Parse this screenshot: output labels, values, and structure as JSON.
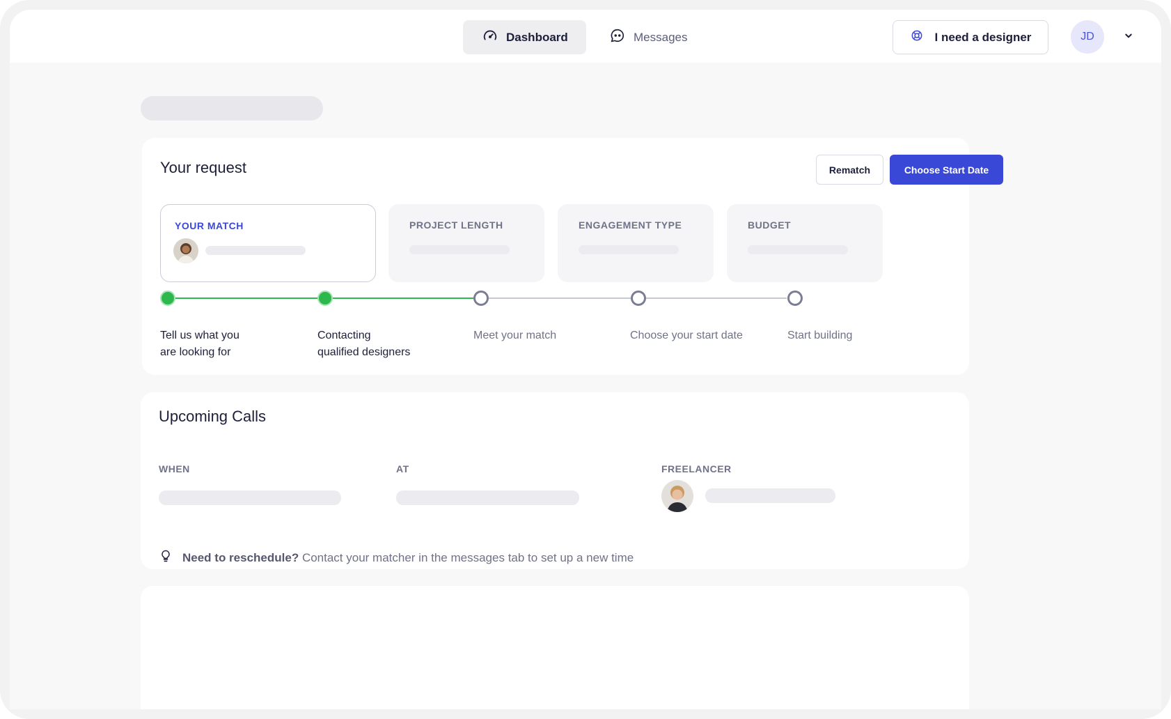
{
  "nav": {
    "tabs": [
      {
        "label": "Dashboard",
        "icon": "speedometer-icon",
        "active": true
      },
      {
        "label": "Messages",
        "icon": "chat-bubble-icon",
        "active": false
      }
    ],
    "cta_label": "I need a designer",
    "cta_icon": "lifebuoy-icon",
    "user_initials": "JD"
  },
  "request": {
    "title": "Your request",
    "rematch_label": "Rematch",
    "start_date_label": "Choose Start Date",
    "info": [
      {
        "label": "YOUR MATCH"
      },
      {
        "label": "PROJECT LENGTH"
      },
      {
        "label": "ENGAGEMENT TYPE"
      },
      {
        "label": "BUDGET"
      }
    ],
    "steps": [
      {
        "line1": "Tell us what you",
        "line2": "are looking for",
        "status": "complete"
      },
      {
        "line1": "Contacting",
        "line2": "qualified designers",
        "status": "complete"
      },
      {
        "line1": "Meet your match",
        "line2": "",
        "status": "pending"
      },
      {
        "line1": "Choose your start date",
        "line2": "",
        "status": "pending"
      },
      {
        "line1": "Start building",
        "line2": "",
        "status": "pending"
      }
    ]
  },
  "calls": {
    "title": "Upcoming Calls",
    "columns": [
      "WHEN",
      "AT",
      "FREELANCER"
    ],
    "tip_bold": "Need to reschedule?",
    "tip_text": " Contact your matcher in the messages tab to set up a new time"
  },
  "colors": {
    "accent": "#3a48d8",
    "complete": "#2db84d",
    "pending": "#7b7e93"
  }
}
